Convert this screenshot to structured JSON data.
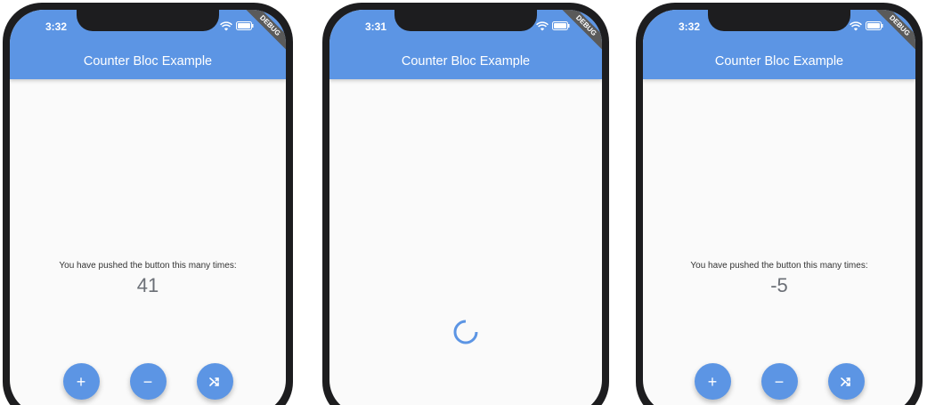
{
  "colors": {
    "primary": "#5c95e4",
    "frame": "#1d1d1f",
    "background": "#fafafa"
  },
  "screens": [
    {
      "status_time": "3:32",
      "app_title": "Counter Bloc Example",
      "debug_label": "DEBUG",
      "caption": "You have pushed the button this many times:",
      "count": "41",
      "state": "loaded",
      "buttons": [
        {
          "label": "+",
          "icon": "plus-icon"
        },
        {
          "label": "−",
          "icon": "minus-icon"
        },
        {
          "label": "",
          "icon": "shuffle-icon"
        }
      ]
    },
    {
      "status_time": "3:31",
      "app_title": "Counter Bloc Example",
      "debug_label": "DEBUG",
      "state": "loading",
      "spinner_icon": "loading-spinner-icon"
    },
    {
      "status_time": "3:32",
      "app_title": "Counter Bloc Example",
      "debug_label": "DEBUG",
      "caption": "You have pushed the button this many times:",
      "count": "-5",
      "state": "loaded",
      "buttons": [
        {
          "label": "+",
          "icon": "plus-icon"
        },
        {
          "label": "−",
          "icon": "minus-icon"
        },
        {
          "label": "",
          "icon": "shuffle-icon"
        }
      ]
    }
  ]
}
